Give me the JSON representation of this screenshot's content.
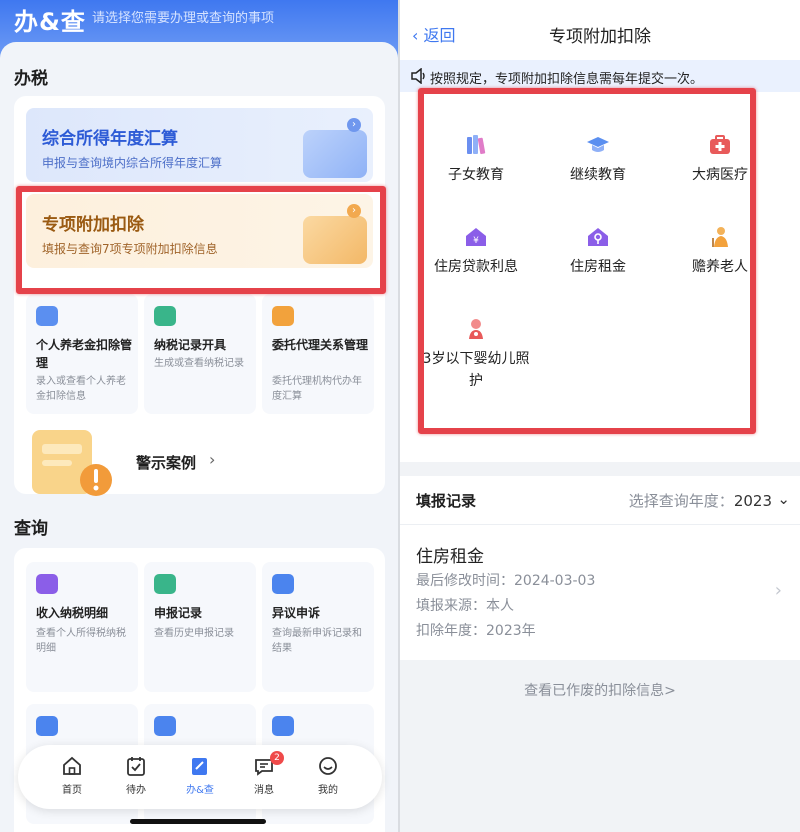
{
  "left": {
    "header": {
      "logo": "办&查",
      "slogan": "请选择您需要办理或查询的事项"
    },
    "tax_section": {
      "title": "办税",
      "annual": {
        "title": "综合所得年度汇算",
        "subtitle": "申报与查询境内综合所得年度汇算"
      },
      "special": {
        "title": "专项附加扣除",
        "subtitle": "填报与查询7项专项附加扣除信息"
      },
      "tiles": [
        {
          "title": "个人养老金扣除管理",
          "desc": "录入或查看个人养老金扣除信息"
        },
        {
          "title": "纳税记录开具",
          "desc": "生成或查看纳税记录"
        },
        {
          "title": "委托代理关系管理",
          "desc": "委托代理机构代办年度汇算"
        }
      ],
      "warning": {
        "label": "警示案例"
      }
    },
    "query_section": {
      "title": "查询",
      "tiles": [
        {
          "title": "收入纳税明细",
          "desc": "查看个人所得税纳税明细"
        },
        {
          "title": "申报记录",
          "desc": "查看历史申报记录"
        },
        {
          "title": "异议申诉",
          "desc": "查询最新申诉记录和结果"
        }
      ]
    },
    "tabbar": {
      "items": [
        {
          "label": "首页"
        },
        {
          "label": "待办"
        },
        {
          "label": "办&查"
        },
        {
          "label": "消息",
          "badge": "2"
        },
        {
          "label": "我的"
        }
      ]
    },
    "colors": {
      "brand": "#3f78f0",
      "highlight": "#e5424a"
    }
  },
  "right": {
    "nav": {
      "back": "返回",
      "title": "专项附加扣除"
    },
    "notice": "按照规定，专项附加扣除信息需每年提交一次。",
    "categories": [
      {
        "label": "子女教育",
        "icon": "books-icon"
      },
      {
        "label": "继续教育",
        "icon": "graduation-cap-icon"
      },
      {
        "label": "大病医疗",
        "icon": "medical-kit-icon"
      },
      {
        "label": "住房贷款利息",
        "icon": "house-yuan-icon"
      },
      {
        "label": "住房租金",
        "icon": "house-key-icon"
      },
      {
        "label": "赡养老人",
        "icon": "elder-icon"
      },
      {
        "label": "3岁以下婴幼儿照护",
        "icon": "baby-care-icon"
      }
    ],
    "records": {
      "header": "填报记录",
      "year_label": "选择查询年度：",
      "year_value": "2023",
      "item": {
        "title": "住房租金",
        "modified_label": "最后修改时间：",
        "modified_value": "2024-03-03",
        "source_label": "填报来源：",
        "source_value": "本人",
        "year_label": "扣除年度：",
        "year_value": "2023年"
      },
      "view_void": "查看已作废的扣除信息>"
    }
  }
}
